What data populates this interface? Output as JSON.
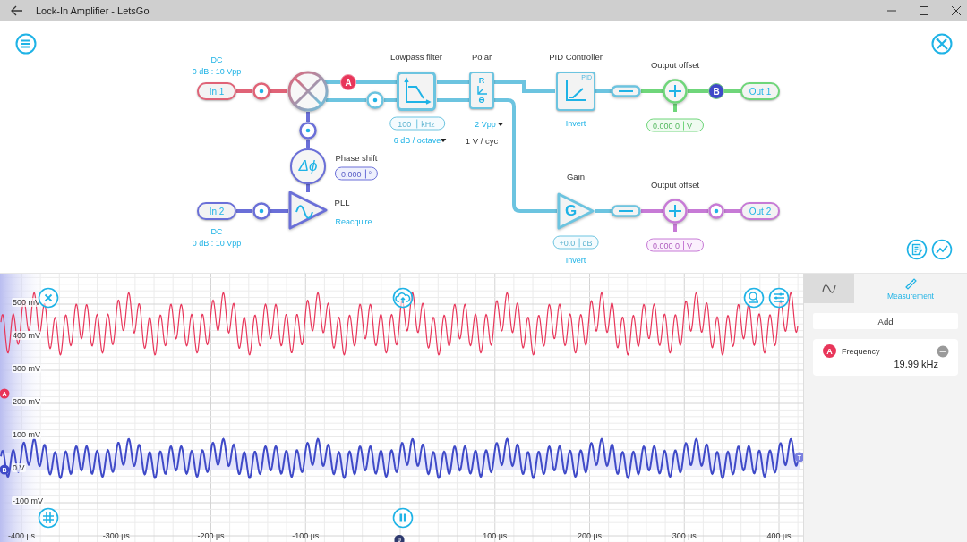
{
  "window": {
    "title": "Lock-In Amplifier - LetsGo"
  },
  "diagram": {
    "inputs": [
      {
        "label": "In 1",
        "coupling": "DC",
        "range": "0 dB : 10 Vpp"
      },
      {
        "label": "In 2",
        "coupling": "DC",
        "range": "0 dB : 10 Vpp"
      }
    ],
    "mixer_badge": "A",
    "lowpass_filter": {
      "title": "Lowpass filter",
      "value": "100",
      "unit": "kHz",
      "slope": "6 dB / octave"
    },
    "polar": {
      "title": "Polar",
      "symbols": [
        "R",
        "ϴ"
      ],
      "range": "2 Vpp",
      "scale": "1 V / cyc"
    },
    "phase_shift": {
      "title": "Phase shift",
      "symbol": "Δϕ",
      "value": "0.000",
      "unit": "°"
    },
    "pll": {
      "title": "PLL",
      "action": "Reacquire"
    },
    "pid": {
      "title": "PID Controller",
      "icon_text": "PID",
      "action": "Invert"
    },
    "gain": {
      "title": "Gain",
      "symbol": "G",
      "value": "+0.0",
      "unit": "dB",
      "action": "Invert"
    },
    "outputs": [
      {
        "offset_title": "Output offset",
        "offset_value": "0.000 0",
        "unit": "V",
        "badge": "B",
        "label": "Out 1"
      },
      {
        "offset_title": "Output offset",
        "offset_value": "0.000 0",
        "unit": "V",
        "label": "Out 2"
      }
    ]
  },
  "scope": {
    "channels": [
      {
        "label": "A",
        "color": "#e8365a"
      },
      {
        "label": "B",
        "color": "#3f4ac8"
      }
    ],
    "y_ticks": [
      "500 mV",
      "400 mV",
      "300 mV",
      "200 mV",
      "100 mV",
      "0 V",
      "-100 mV"
    ],
    "x_ticks": [
      "-400 µs",
      "-300 µs",
      "-200 µs",
      "-100 µs",
      "100 µs",
      "200 µs",
      "300 µs",
      "400 µs"
    ],
    "trigger_marker": "0",
    "level_marker": "T"
  },
  "panel": {
    "tabs": [
      {
        "kind": "waveform",
        "selected": false
      },
      {
        "kind": "measurement",
        "label": "Measurement",
        "selected": true
      }
    ],
    "add_button": "Add",
    "measurements": [
      {
        "channel": "A",
        "name": "Frequency",
        "value": "19.99 kHz"
      }
    ]
  }
}
